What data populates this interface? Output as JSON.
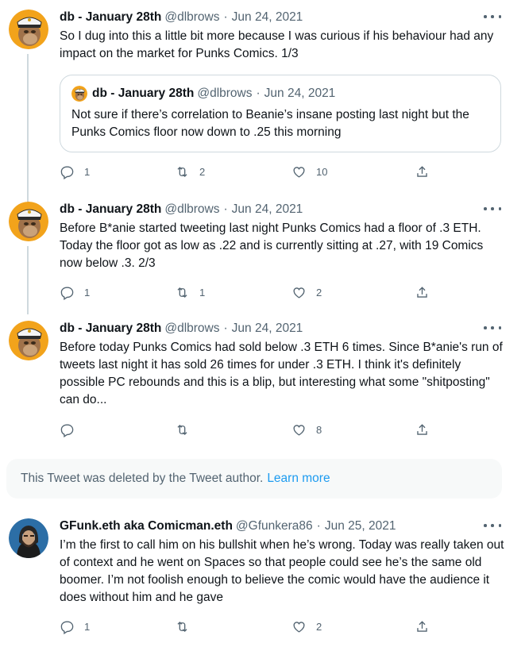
{
  "colors": {
    "link": "#1d9bf0",
    "muted": "#536471",
    "text": "#0f1419",
    "border": "#cfd9de",
    "deleted_bg": "#f7f9f9"
  },
  "tweets": [
    {
      "name": "db - January 28th",
      "handle": "@dlbrows",
      "date": "Jun 24, 2021",
      "text": "So I dug into this a little bit more because I was curious if his behaviour had any impact on the market for Punks Comics. 1/3",
      "quote": {
        "name": "db - January 28th",
        "handle": "@dlbrows",
        "date": "Jun 24, 2021",
        "text": "Not sure if there’s correlation to Beanie’s insane posting last night but the Punks Comics floor now down to .25 this morning"
      },
      "replies": "1",
      "retweets": "2",
      "likes": "10"
    },
    {
      "name": "db - January 28th",
      "handle": "@dlbrows",
      "date": "Jun 24, 2021",
      "text": "Before B*anie started tweeting last night Punks Comics had a floor of .3 ETH. Today the floor got as low as .22 and is currently sitting at .27, with 19 Comics now below .3. 2/3",
      "replies": "1",
      "retweets": "1",
      "likes": "2"
    },
    {
      "name": "db - January 28th",
      "handle": "@dlbrows",
      "date": "Jun 24, 2021",
      "text": "Before today Punks Comics had sold below .3 ETH 6 times. Since B*anie's run of tweets last night it has sold 26 times for under .3 ETH. I think it's definitely possible PC rebounds and this is a blip, but interesting what some \"shitposting\" can do...",
      "replies": "",
      "retweets": "",
      "likes": "8"
    },
    {
      "name": "GFunk.eth aka Comicman.eth",
      "handle": "@Gfunkera86",
      "date": "Jun 25, 2021",
      "text": "I’m the first to call him on his bullshit when he’s wrong. Today was really taken out of context and he went on Spaces so that people could see he’s the same old boomer. I’m not foolish enough to believe the comic would have the audience it does without him and he gave",
      "replies": "1",
      "retweets": "",
      "likes": "2"
    }
  ],
  "deleted": {
    "text": "This Tweet was deleted by the Tweet author.",
    "learn_more": "Learn more"
  },
  "separator": "·"
}
